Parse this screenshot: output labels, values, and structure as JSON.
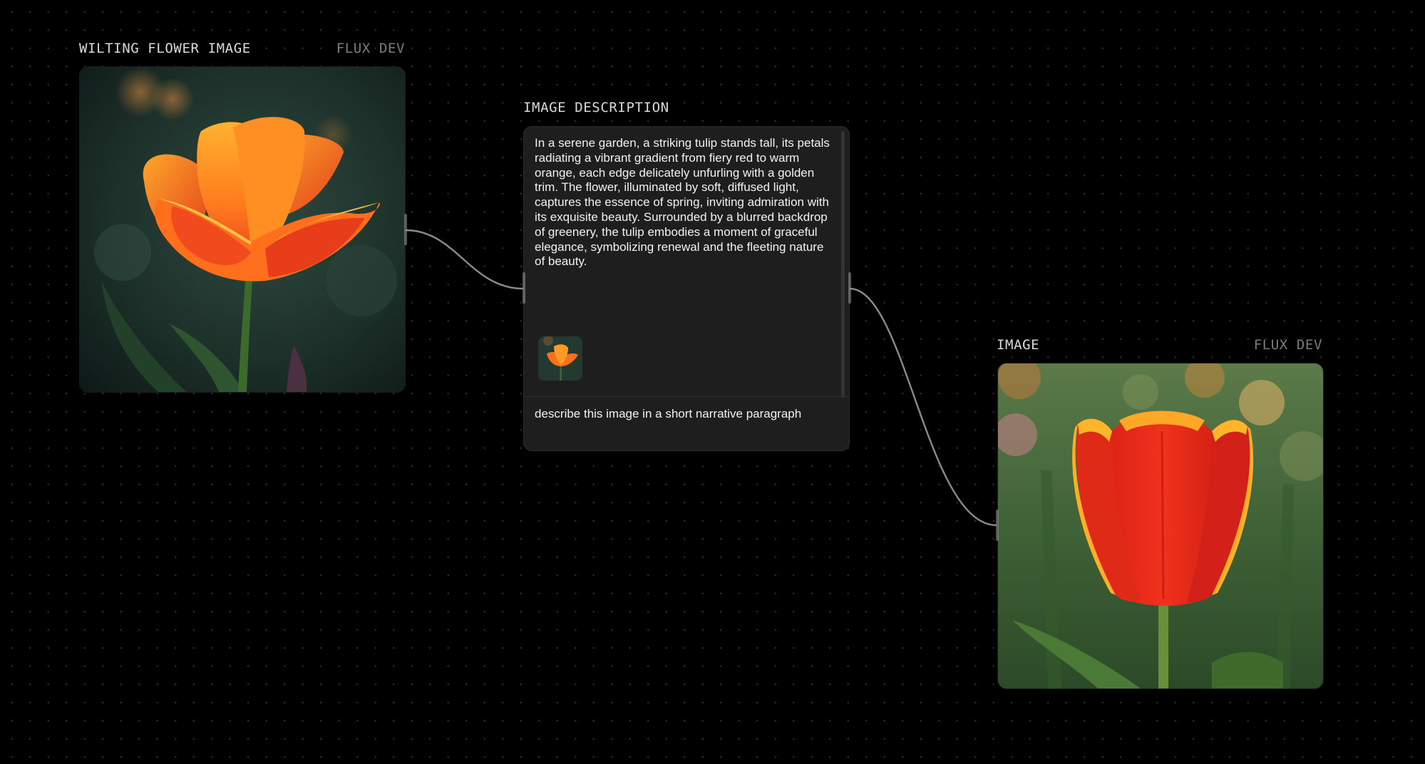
{
  "nodes": {
    "source_image": {
      "title": "WILTING FLOWER IMAGE",
      "model": "FLUX DEV",
      "image_description": "orange-red ruffled tulip, dark green bokeh background"
    },
    "image_description": {
      "title": "IMAGE DESCRIPTION",
      "output_text": "In a serene garden, a striking tulip stands tall, its petals radiating a vibrant gradient from fiery red to warm orange, each edge delicately unfurling with a golden trim. The flower, illuminated by soft, diffused light, captures the essence of spring, inviting admiration with its exquisite beauty. Surrounded by a blurred backdrop of greenery, the tulip embodies a moment of graceful elegance, symbolizing renewal and the fleeting nature of beauty.",
      "prompt": "describe this image in a short narrative paragraph"
    },
    "result_image": {
      "title": "IMAGE",
      "model": "FLUX DEV",
      "image_description": "closed red tulip with yellow edges, green field background"
    }
  },
  "colors": {
    "background": "#000000",
    "card": "#1e1e1e",
    "edge": "#8a8a8a",
    "title_text": "#d9d9d9",
    "model_text": "#7c7c7c"
  }
}
